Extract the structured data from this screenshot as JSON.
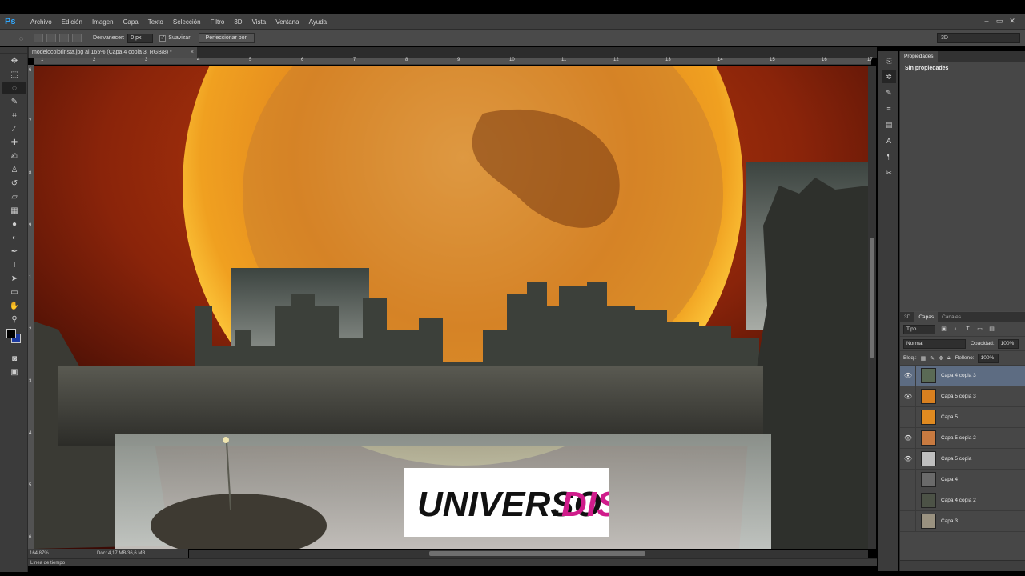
{
  "app": {
    "logo": "Ps",
    "menu": [
      "Archivo",
      "Edición",
      "Imagen",
      "Capa",
      "Texto",
      "Selección",
      "Filtro",
      "3D",
      "Vista",
      "Ventana",
      "Ayuda"
    ],
    "window_controls": [
      "–",
      "▭",
      "✕"
    ]
  },
  "options": {
    "feather_label": "Desvanecer:",
    "feather_value": "0 px",
    "antialias_label": "Suavizar",
    "refine_button": "Perfeccionar bor.",
    "workspace": "3D"
  },
  "document": {
    "tab_title": "modelocolorinsta.jpg al 165% (Capa 4 copia 3, RGB/8) *",
    "zoom": "164,87%",
    "doc_size": "Doc: 4,17 MB/36,6 MB",
    "ruler_h": [
      "1",
      "2",
      "3",
      "4",
      "5",
      "6",
      "7",
      "8",
      "9",
      "10",
      "11",
      "12",
      "13",
      "14",
      "15",
      "16",
      "17"
    ],
    "ruler_v": [
      "6",
      "7",
      "8",
      "9",
      "1",
      "2",
      "3",
      "4",
      "5",
      "6"
    ],
    "watermark": {
      "text_main": "UNIVERSO",
      "text_dot": ".",
      "text_end": "DIS"
    }
  },
  "timeline": {
    "label": "Línea de tiempo"
  },
  "properties_panel": {
    "tab": "Propiedades",
    "message": "Sin propiedades"
  },
  "layers_panel": {
    "tabs": [
      "3D",
      "Capas",
      "Canales"
    ],
    "filter": "Tipo",
    "blend_mode": "Normal",
    "opacity_label": "Opacidad:",
    "opacity_value": "100%",
    "lock_label": "Bloq.:",
    "fill_label": "Relleno:",
    "fill_value": "100%",
    "layers": [
      {
        "name": "Capa 4 copia 3",
        "visible": true,
        "selected": true,
        "thumb": "#5a6a55"
      },
      {
        "name": "Capa 5 copia 3",
        "visible": true,
        "selected": false,
        "thumb": "#d9801f"
      },
      {
        "name": "Capa 5",
        "visible": false,
        "selected": false,
        "thumb": "#e08a20"
      },
      {
        "name": "Capa 5 copia 2",
        "visible": true,
        "selected": false,
        "thumb": "#c87a40"
      },
      {
        "name": "Capa 5 copia",
        "visible": true,
        "selected": false,
        "thumb": "#bfbfbf"
      },
      {
        "name": "Capa 4",
        "visible": false,
        "selected": false,
        "thumb": "#6a6a6a"
      },
      {
        "name": "Capa 4 copia 2",
        "visible": false,
        "selected": false,
        "thumb": "#4c5246"
      },
      {
        "name": "Capa 3",
        "visible": false,
        "selected": false,
        "thumb": "#9a9280"
      }
    ]
  },
  "colors": {
    "foreground": "#000000",
    "background": "#1c3aa0",
    "accent": "#31a8ff"
  }
}
